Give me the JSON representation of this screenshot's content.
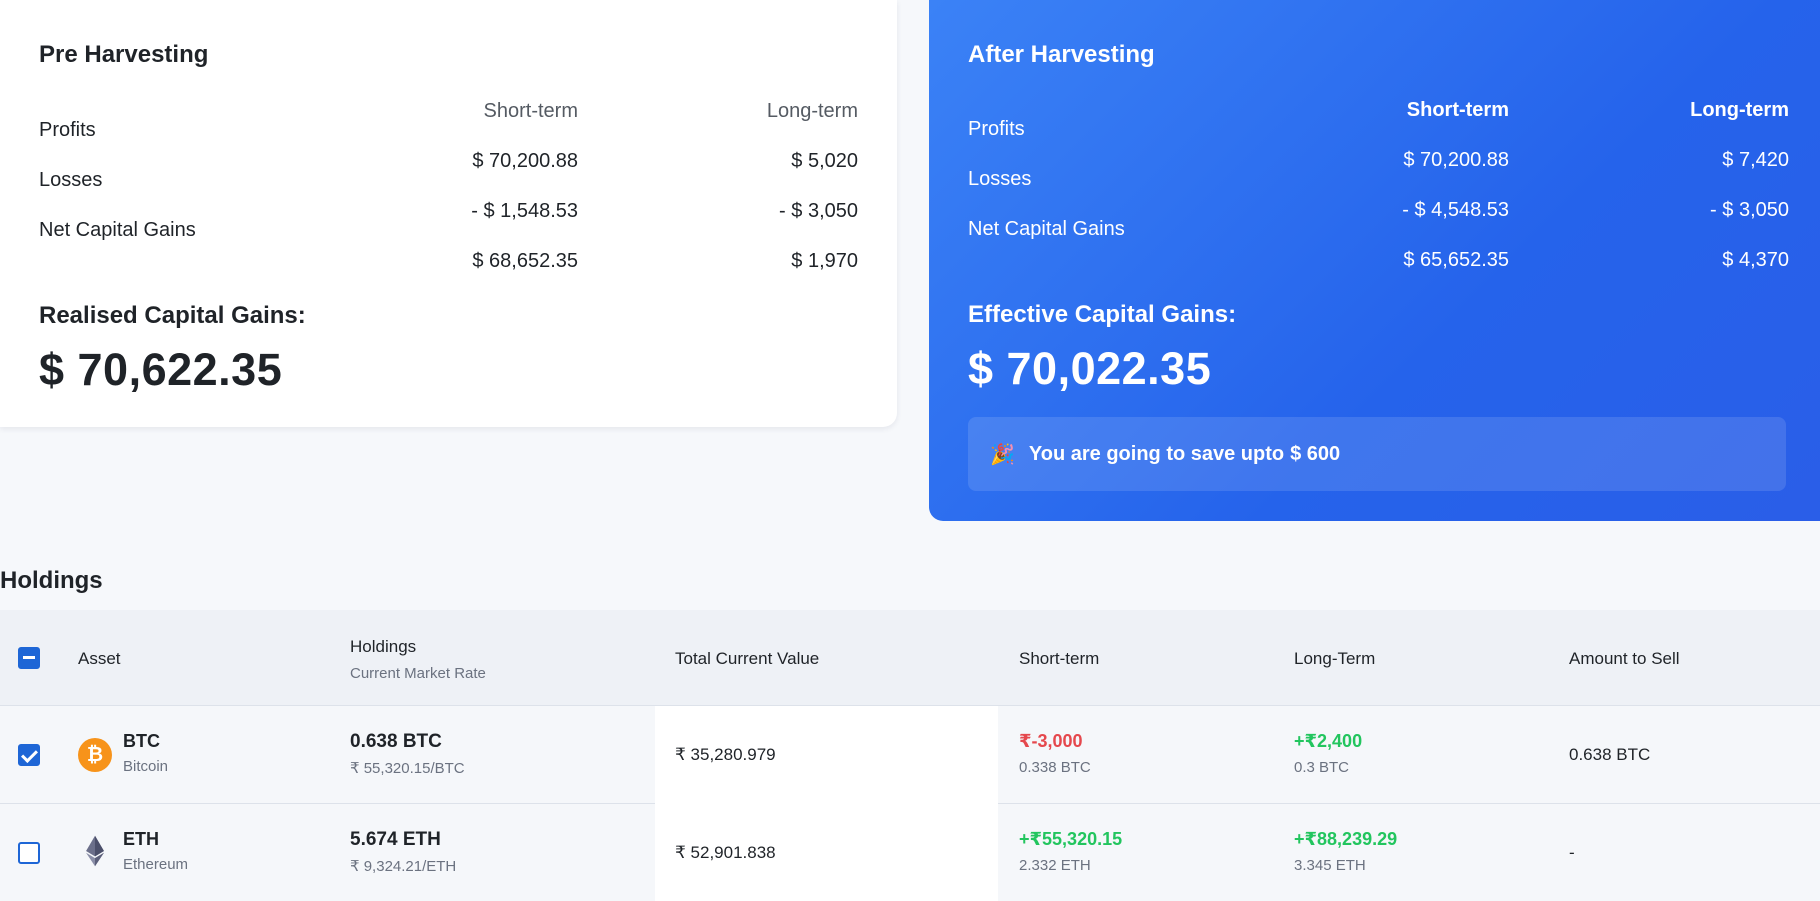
{
  "pre": {
    "title": "Pre Harvesting",
    "col_short": "Short-term",
    "col_long": "Long-term",
    "row_profits": "Profits",
    "row_losses": "Losses",
    "row_net": "Net Capital Gains",
    "profits_short": "$ 70,200.88",
    "profits_long": "$ 5,020",
    "losses_short": "- $ 1,548.53",
    "losses_long": "- $ 3,050",
    "net_short": "$ 68,652.35",
    "net_long": "$ 1,970",
    "gains_label": "Realised Capital Gains:",
    "gains_value": "$ 70,622.35"
  },
  "after": {
    "title": "After Harvesting",
    "col_short": "Short-term",
    "col_long": "Long-term",
    "row_profits": "Profits",
    "row_losses": "Losses",
    "row_net": "Net Capital Gains",
    "profits_short": "$ 70,200.88",
    "profits_long": "$ 7,420",
    "losses_short": "- $ 4,548.53",
    "losses_long": "- $ 3,050",
    "net_short": "$ 65,652.35",
    "net_long": "$ 4,370",
    "gains_label": "Effective Capital Gains:",
    "gains_value": "$ 70,022.35",
    "save_text": "You are going to save upto",
    "save_amount": "$ 600",
    "save_icon": "🎉"
  },
  "holdings": {
    "title": "Holdings",
    "headers": {
      "asset": "Asset",
      "holdings": "Holdings",
      "holdings_sub": "Current Market Rate",
      "total": "Total Current Value",
      "short": "Short-term",
      "long": "Long-Term",
      "sell": "Amount to Sell"
    },
    "rows": [
      {
        "symbol": "BTC",
        "name": "Bitcoin",
        "icon": "₿",
        "holdings": "0.638 BTC",
        "rate": "₹ 55,320.15/BTC",
        "total": "₹ 35,280.979",
        "short": "₹-3,000",
        "short_sub": "0.338 BTC",
        "long": "+₹2,400",
        "long_sub": "0.3 BTC",
        "sell": "0.638 BTC"
      },
      {
        "symbol": "ETH",
        "name": "Ethereum",
        "holdings": "5.674 ETH",
        "rate": "₹ 9,324.21/ETH",
        "total": "₹ 52,901.838",
        "short": "+₹55,320.15",
        "short_sub": "2.332 ETH",
        "long": "+₹88,239.29",
        "long_sub": "3.345 ETH",
        "sell": "-"
      }
    ]
  },
  "colors": {
    "accent": "#2563eb",
    "loss": "#e5484d",
    "gain": "#22c55e",
    "btc": "#f7931a"
  }
}
